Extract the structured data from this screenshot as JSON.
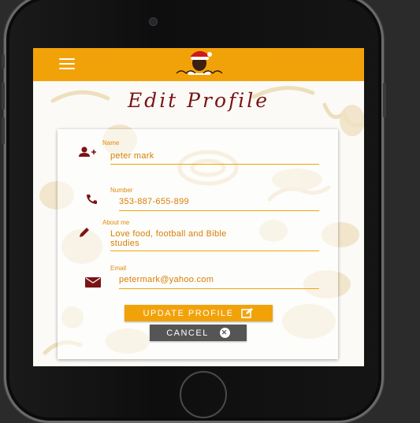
{
  "app": {
    "logo_icon": "chef-santa-logo-icon",
    "menu_icon": "hamburger-menu-icon",
    "accent_color": "#f2a209",
    "title_color": "#7a1414"
  },
  "page": {
    "title": "Edit Profile"
  },
  "form": {
    "name": {
      "label": "Name",
      "value": "peter mark",
      "icon": "add-user-icon"
    },
    "number": {
      "label": "Number",
      "value": "353-887-655-899",
      "icon": "phone-icon"
    },
    "about": {
      "label": "About me",
      "value_line1": "Love food, football and Bible",
      "value_line2": "studies",
      "icon": "pencil-icon"
    },
    "email": {
      "label": "Email",
      "value": "petermark@yahoo.com",
      "icon": "envelope-icon"
    }
  },
  "buttons": {
    "update_label": "UPDATE PROFILE",
    "update_icon": "edit-icon",
    "cancel_label": "CANCEL",
    "cancel_icon": "close-circle-icon"
  }
}
